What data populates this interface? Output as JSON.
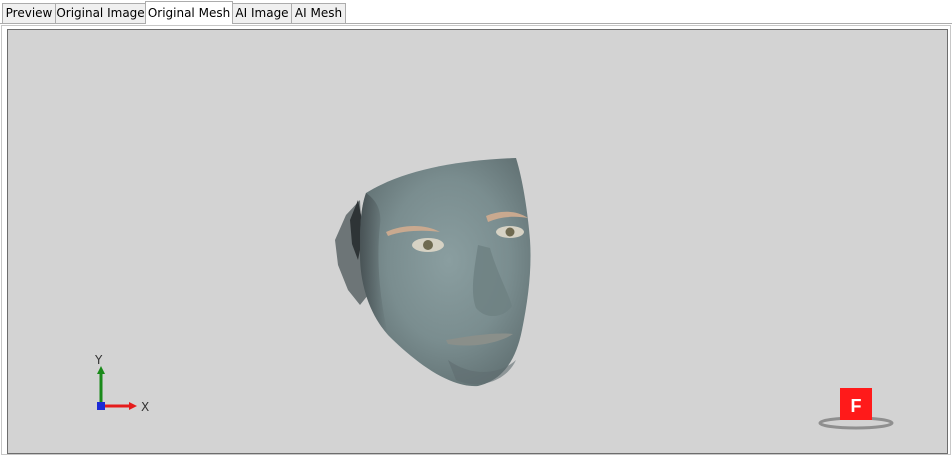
{
  "tabs": [
    {
      "label": "Preview",
      "active": false
    },
    {
      "label": "Original Image",
      "active": false
    },
    {
      "label": "Original Mesh",
      "active": true
    },
    {
      "label": "AI Image",
      "active": false
    },
    {
      "label": "AI Mesh",
      "active": false
    }
  ],
  "viewport": {
    "background": "#d3d3d3",
    "axes": {
      "y_label": "Y",
      "x_label": "X",
      "x_color": "#e51c1c",
      "y_color": "#1a8a1a",
      "z_color": "#1c2ad6"
    },
    "view_cube": {
      "face_label": "F",
      "face_color": "#ff1a1a"
    }
  }
}
